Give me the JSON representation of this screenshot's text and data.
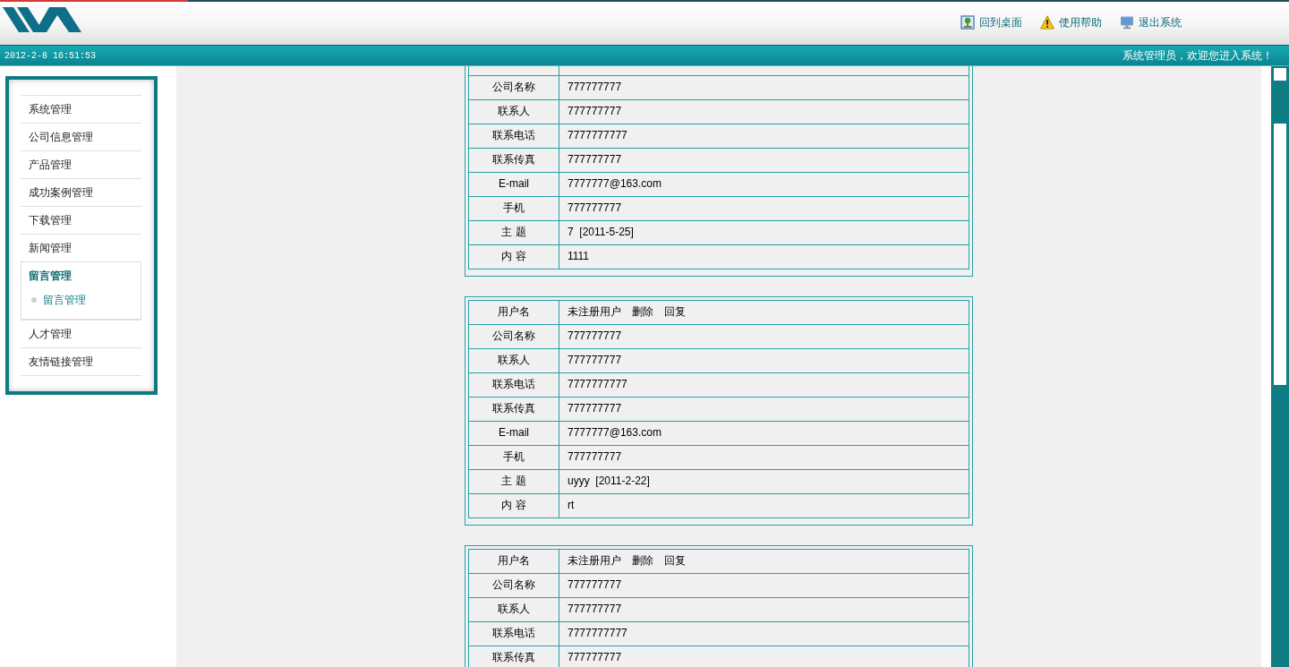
{
  "header": {
    "links": [
      {
        "kind": "desktop",
        "label": "回到桌面"
      },
      {
        "kind": "help",
        "label": "使用帮助"
      },
      {
        "kind": "exit",
        "label": "退出系统"
      }
    ]
  },
  "status_bar": {
    "datetime": "2012-2-8 16:51:53",
    "welcome": "系统管理员，欢迎您进入系统！"
  },
  "sidebar": {
    "items": [
      {
        "label": "系统管理",
        "expanded": false
      },
      {
        "label": "公司信息管理",
        "expanded": false
      },
      {
        "label": "产品管理",
        "expanded": false
      },
      {
        "label": "成功案例管理",
        "expanded": false
      },
      {
        "label": "下载管理",
        "expanded": false
      },
      {
        "label": "新闻管理",
        "expanded": false
      },
      {
        "label": "留言管理",
        "expanded": true,
        "children": [
          {
            "label": "留言管理"
          }
        ]
      },
      {
        "label": "人才管理",
        "expanded": false
      },
      {
        "label": "友情链接管理",
        "expanded": false
      }
    ]
  },
  "messages": [
    {
      "rows": [
        {
          "label": "公司名称",
          "value": "777777777"
        },
        {
          "label": "联系人",
          "value": "777777777"
        },
        {
          "label": "联系电话",
          "value": "7777777777"
        },
        {
          "label": "联系传真",
          "value": "777777777"
        },
        {
          "label": "E-mail",
          "value": "7777777@163.com"
        },
        {
          "label": "手机",
          "value": "777777777"
        },
        {
          "label": "主 题",
          "value": "7  [2011-5-25]"
        },
        {
          "label": "内 容",
          "value": "1111"
        }
      ]
    },
    {
      "rows": [
        {
          "label": "用户名",
          "value": "未注册用户",
          "actions": [
            "删除",
            "回复"
          ]
        },
        {
          "label": "公司名称",
          "value": "777777777"
        },
        {
          "label": "联系人",
          "value": "777777777"
        },
        {
          "label": "联系电话",
          "value": "7777777777"
        },
        {
          "label": "联系传真",
          "value": "777777777"
        },
        {
          "label": "E-mail",
          "value": "7777777@163.com"
        },
        {
          "label": "手机",
          "value": "777777777"
        },
        {
          "label": "主 题",
          "value": "uyyy  [2011-2-22]"
        },
        {
          "label": "内 容",
          "value": "rt"
        }
      ]
    },
    {
      "rows": [
        {
          "label": "用户名",
          "value": "未注册用户",
          "actions": [
            "删除",
            "回复"
          ]
        },
        {
          "label": "公司名称",
          "value": "777777777"
        },
        {
          "label": "联系人",
          "value": "777777777"
        },
        {
          "label": "联系电话",
          "value": "7777777777"
        },
        {
          "label": "联系传真",
          "value": "777777777"
        }
      ]
    }
  ]
}
